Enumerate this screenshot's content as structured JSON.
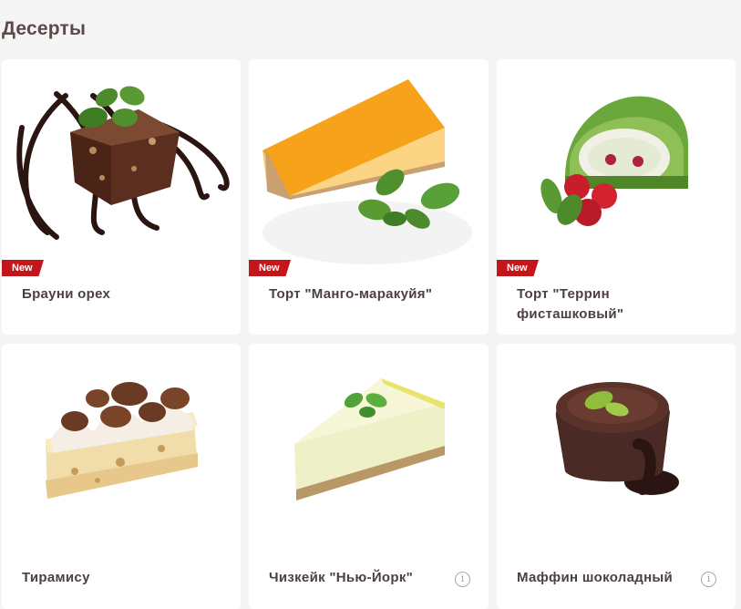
{
  "section": {
    "title": "Десерты"
  },
  "products": [
    {
      "name": "Брауни орех",
      "badge": "New",
      "photo": "brownie-walnut-image"
    },
    {
      "name": "Торт \"Манго-маракуйя\"",
      "badge": "New",
      "photo": "mango-passionfruit-cake-image"
    },
    {
      "name": "Торт \"Террин фисташковый\"",
      "badge": "New",
      "photo": "pistachio-terrine-cake-image"
    },
    {
      "name": "Тирамису",
      "photo": "tiramisu-image"
    },
    {
      "name": "Чизкейк \"Нью-Йорк\"",
      "photo": "new-york-cheesecake-image",
      "info_icon": "info-icon"
    },
    {
      "name": "Маффин шоколадный",
      "photo": "chocolate-muffin-image",
      "info_icon": "info-icon"
    }
  ],
  "info_glyph": "i",
  "colors": {
    "badge": "#c2161b",
    "title": "#5b4a48",
    "card_text": "#4c4040",
    "background": "#f5f5f5"
  }
}
